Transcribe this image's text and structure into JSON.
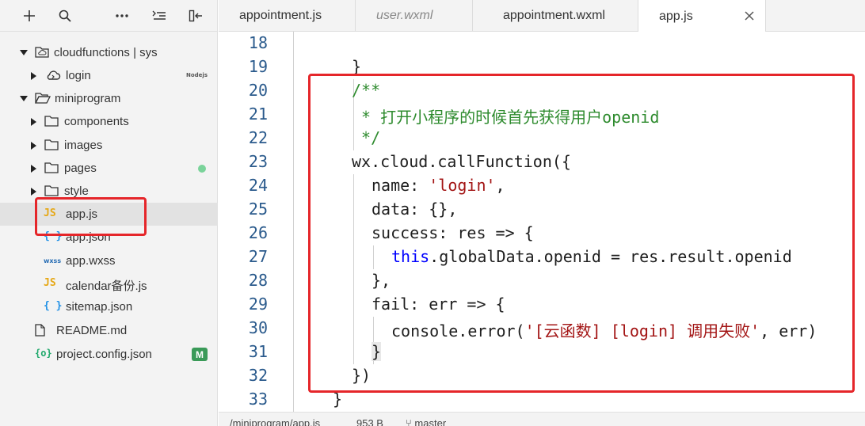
{
  "toolbar": {
    "add_icon": "plus-icon",
    "search_icon": "search-icon",
    "more_icon": "ellipsis-icon",
    "collapse_icon": "collapse-all-icon",
    "split_icon": "split-view-icon"
  },
  "sidebar": {
    "items": [
      {
        "label": "cloudfunctions | sys",
        "icon": "cloud-folder-icon"
      },
      {
        "label": "login",
        "icon": "cloud-function-icon",
        "badge": "Nodejs"
      },
      {
        "label": "miniprogram",
        "icon": "folder-open-icon"
      },
      {
        "label": "components",
        "icon": "folder-icon"
      },
      {
        "label": "images",
        "icon": "folder-icon"
      },
      {
        "label": "pages",
        "icon": "folder-icon"
      },
      {
        "label": "style",
        "icon": "folder-icon"
      },
      {
        "label": "app.js",
        "icon_text": "JS"
      },
      {
        "label": "app.json",
        "icon_text": "{ }"
      },
      {
        "label": "app.wxss",
        "icon_text": "wxss"
      },
      {
        "label": "calendar备份.js",
        "icon_text": "JS"
      },
      {
        "label": "sitemap.json",
        "icon_text": "{ }"
      },
      {
        "label": "README.md",
        "icon": "file-icon"
      },
      {
        "label": "project.config.json",
        "icon_text": "{o}",
        "badge": "M"
      }
    ]
  },
  "tabs": [
    {
      "label": "appointment.js"
    },
    {
      "label": "user.wxml"
    },
    {
      "label": "appointment.wxml"
    },
    {
      "label": "app.js"
    }
  ],
  "editor": {
    "lines": [
      {
        "n": "18",
        "text": ""
      },
      {
        "n": "19",
        "text": "}"
      },
      {
        "n": "20",
        "text": "/**"
      },
      {
        "n": "21",
        "text": " * 打开小程序的时候首先获得用户openid"
      },
      {
        "n": "22",
        "text": " */"
      },
      {
        "n": "23",
        "text": "wx.cloud.callFunction({"
      },
      {
        "n": "24",
        "pre": "name: ",
        "str": "'login'",
        "post": ","
      },
      {
        "n": "25",
        "text": "data: {},"
      },
      {
        "n": "26",
        "text": "success: res => {"
      },
      {
        "n": "27",
        "kw": "this",
        "post": ".globalData.openid = res.result.openid"
      },
      {
        "n": "28",
        "text": "},"
      },
      {
        "n": "29",
        "text": "fail: err => {"
      },
      {
        "n": "30",
        "pre": "console.error(",
        "str": "'[云函数] [login] 调用失败'",
        "post": ", err)"
      },
      {
        "n": "31",
        "text": "}"
      },
      {
        "n": "32",
        "text": "})"
      },
      {
        "n": "33",
        "text": "}"
      }
    ]
  },
  "statusbar": {
    "path": "/miniprogram/app.js",
    "size": "953 B",
    "branch": "master"
  },
  "colors": {
    "annotation": "#e5262a",
    "comment": "#2e8b2e",
    "string": "#a31515",
    "keyword": "#0000ff"
  }
}
